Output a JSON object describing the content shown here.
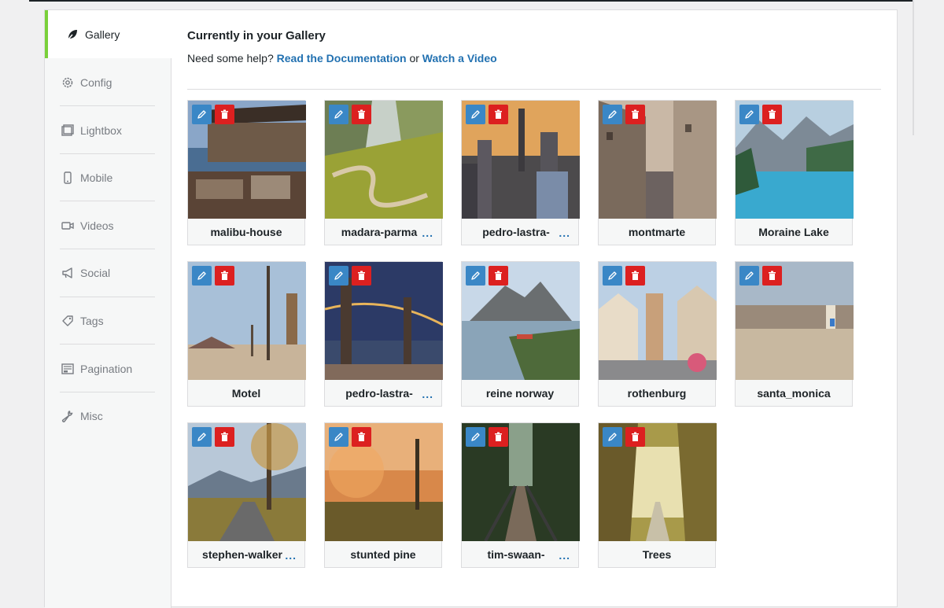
{
  "sidebar": {
    "items": [
      {
        "label": "Gallery",
        "icon": "leaf-icon",
        "active": true
      },
      {
        "label": "Config",
        "icon": "gear-icon"
      },
      {
        "label": "Lightbox",
        "icon": "lightbox-icon"
      },
      {
        "label": "Mobile",
        "icon": "mobile-icon"
      },
      {
        "label": "Videos",
        "icon": "video-camera-icon"
      },
      {
        "label": "Social",
        "icon": "megaphone-icon"
      },
      {
        "label": "Tags",
        "icon": "tag-icon"
      },
      {
        "label": "Pagination",
        "icon": "pagination-icon"
      },
      {
        "label": "Misc",
        "icon": "wrench-icon"
      }
    ]
  },
  "main": {
    "title": "Currently in your Gallery",
    "help_prefix": "Need some help?",
    "docs_link": "Read the Documentation",
    "help_or": "or",
    "video_link": "Watch a Video",
    "more_indicator": "...",
    "images": [
      {
        "name": "malibu-house",
        "truncated": false
      },
      {
        "name": "madara-parma",
        "truncated": true
      },
      {
        "name": "pedro-lastra-",
        "truncated": true
      },
      {
        "name": "montmarte",
        "truncated": false
      },
      {
        "name": "Moraine Lake",
        "truncated": false
      },
      {
        "name": "Motel",
        "truncated": false
      },
      {
        "name": "pedro-lastra-",
        "truncated": true
      },
      {
        "name": "reine norway",
        "truncated": false
      },
      {
        "name": "rothenburg",
        "truncated": false
      },
      {
        "name": "santa_monica",
        "truncated": false
      },
      {
        "name": "stephen-walker",
        "truncated": true
      },
      {
        "name": "stunted pine",
        "truncated": false
      },
      {
        "name": "tim-swaan-",
        "truncated": true
      },
      {
        "name": "Trees",
        "truncated": false
      }
    ]
  },
  "colors": {
    "accent_active": "#7ad03a",
    "link": "#2271b1",
    "edit_button": "#3a87c6",
    "delete_button": "#dc2020"
  }
}
